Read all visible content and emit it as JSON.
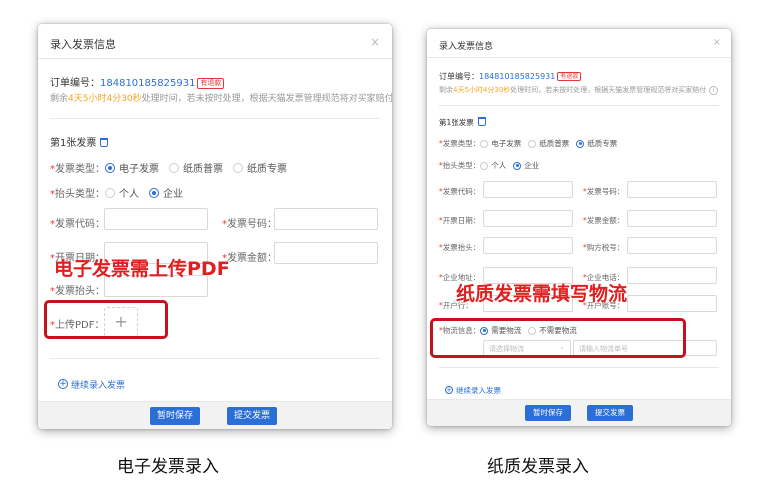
{
  "colors": {
    "brand": "#2b6fd6",
    "required": "#e53935",
    "highlight": "#f5a623",
    "annotation": "#e02020",
    "box": "#c4131f"
  },
  "panel1": {
    "title": "录入发票信息",
    "order_label": "订单编号：",
    "order_no": "184810185825931",
    "badge": "有退款",
    "remain_prefix": "剩余",
    "remain_time": "4天5小时4分30秒",
    "remain_suffix": "处理时间，若未按时处理，根据天猫发票管理规范将对买家赔付",
    "section_title": "第1张发票",
    "type_label": "发票类型：",
    "type_options": [
      "电子发票",
      "纸质普票",
      "纸质专票"
    ],
    "header_label": "抬头类型：",
    "header_options": [
      "个人",
      "企业"
    ],
    "code_label": "发票代码：",
    "number_label": "发票号码：",
    "date_label": "开票日期：",
    "amount_label": "发票金额：",
    "title_label": "发票抬头：",
    "upload_label": "上传PDF：",
    "add_link": "继续录入发票",
    "save_button": "暂时保存",
    "submit_button": "提交发票"
  },
  "panel2": {
    "title": "录入发票信息",
    "order_label": "订单编号：",
    "order_no": "184810185825931",
    "badge": "有退款",
    "remain_prefix": "剩余",
    "remain_time": "4天5小时4分30秒",
    "remain_suffix": "处理时间，若未按时处理，根据天猫发票管理规范将对买家赔付",
    "section_title": "第1张发票",
    "type_label": "发票类型：",
    "type_options": [
      "电子发票",
      "纸质普票",
      "纸质专票"
    ],
    "header_label": "抬头类型：",
    "header_options": [
      "个人",
      "企业"
    ],
    "code_label": "发票代码：",
    "number_label": "发票号码：",
    "date_label": "开票日期：",
    "amount_label": "发票金额：",
    "title_label": "发票抬头：",
    "tax_label": "购方税号：",
    "addr_label": "企业地址：",
    "phone_label": "企业电话：",
    "bank_label": "开户行：",
    "account_label": "开户账号：",
    "logistics_label": "物流信息：",
    "logistics_options": [
      "需要物流",
      "不需要物流"
    ],
    "logistics_select": "请选择物流",
    "tracking_placeholder": "请输入物流单号",
    "add_link": "继续录入发票",
    "save_button": "暂时保存",
    "submit_button": "提交发票"
  },
  "annotations": {
    "electronic": "电子发票需上传PDF",
    "paper": "纸质发票需填写物流"
  },
  "captions": {
    "left": "电子发票录入",
    "right": "纸质发票录入"
  }
}
